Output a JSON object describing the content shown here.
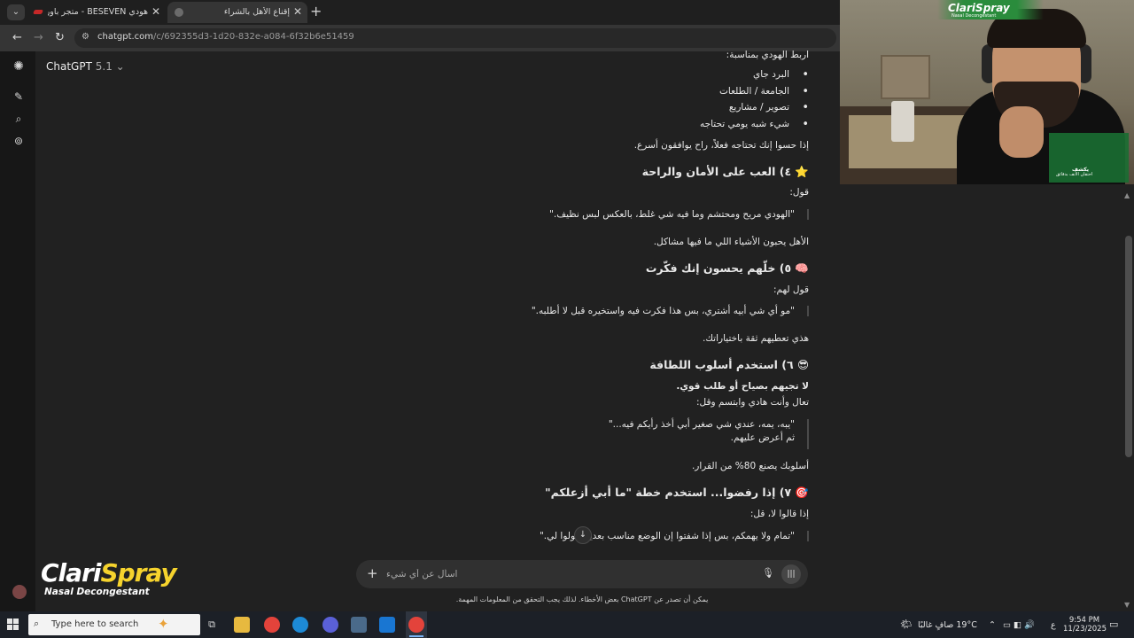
{
  "browser": {
    "tabs": [
      {
        "title": "هودي BESEVEN - متجر باور - ore"
      },
      {
        "title": "إقناع الأهل بالشراء"
      }
    ],
    "url_host": "chatgpt.com",
    "url_path": "/c/692355d3-1d20-832e-a084-6f32b6e51459"
  },
  "app": {
    "name": "ChatGPT",
    "version": "5.1"
  },
  "conversation": {
    "intro_line": "اربط الهودي بمناسبة:",
    "bullets": [
      "البرد جاي",
      "الجامعة / الطلعات",
      "تصوير / مشاريع",
      "شيء شبه يومي تحتاجه"
    ],
    "after_bullets": "إذا حسوا إنك تحتاجه فعلاً، راح يوافقون أسرع.",
    "h4": "⭐ ٤) العب على الأمان والراحة",
    "h4_say": "قول:",
    "h4_quote": "\"الهودي مريح ومحتشم وما فيه شي غلط، بالعكس لبس نظيف.\"",
    "h4_after": "الأهل يحبون الأشياء اللي ما فيها مشاكل.",
    "h5": "🧠 ٥) خلّهم يحسون إنك فكّرت",
    "h5_say": "قول لهم:",
    "h5_quote": "\"مو أي شي أبيه أشتري، بس هذا فكرت فيه واستخيره قبل لا أطلبه.\"",
    "h5_after": "هذي تعطيهم ثقة باختياراتك.",
    "h6": "😎 ٦) استخدم أسلوب اللطافة",
    "h6_bold": "لا تجيهم بصياح أو طلب قوي.",
    "h6_line": "تعال وأنت هادي وابتسم وقل:",
    "h6_quote1": "\"يبه، يمه، عندي شي صغير أبي أخذ رأيكم فيه...\"",
    "h6_quote2": "ثم أعرض عليهم.",
    "h6_after": "أسلوبك يصنع 80% من القرار.",
    "h7": "🎯 ٧) إذا رفضوا... استخدم خطة \"ما أبي أزعلكم\"",
    "h7_say": "إذا قالوا لا، قل:",
    "h7_quote": "\"تمام ولا يهمكم، بس إذا شفتوا إن الوضع مناسب بعدين قولوا لي.\""
  },
  "composer": {
    "placeholder": "اسأل عن أي شيء"
  },
  "disclaimer": "يمكن أن تصدر عن ChatGPT بعض الأخطاء. لذلك يجب التحقق من المعلومات المهمة.",
  "overlay": {
    "webcam_brand": "ClariSpray",
    "webcam_brand_sub": "Nasal Decongestant",
    "product_title": "يكشف",
    "product_sub": "احتقان الأنف بدقائق",
    "logo_name_a": "Clari",
    "logo_name_b": "Spray",
    "logo_sub": "Nasal Decongestant"
  },
  "taskbar": {
    "search_placeholder": "Type here to search",
    "weather": "19°C  صافٍ غالبًا",
    "lang": "ع",
    "time": "9:54 PM",
    "date": "11/23/2025"
  },
  "colors": {
    "background": "#212121",
    "sidebar": "#171717",
    "brand_green": "#2a8c3c",
    "logo_yellow": "#f6d32d"
  },
  "icons": [
    "chatgpt-logo-icon",
    "new-chat-icon",
    "search-icon",
    "library-icon",
    "plus-icon",
    "mic-icon",
    "voice-mode-icon",
    "scroll-down-icon",
    "windows-start-icon"
  ]
}
